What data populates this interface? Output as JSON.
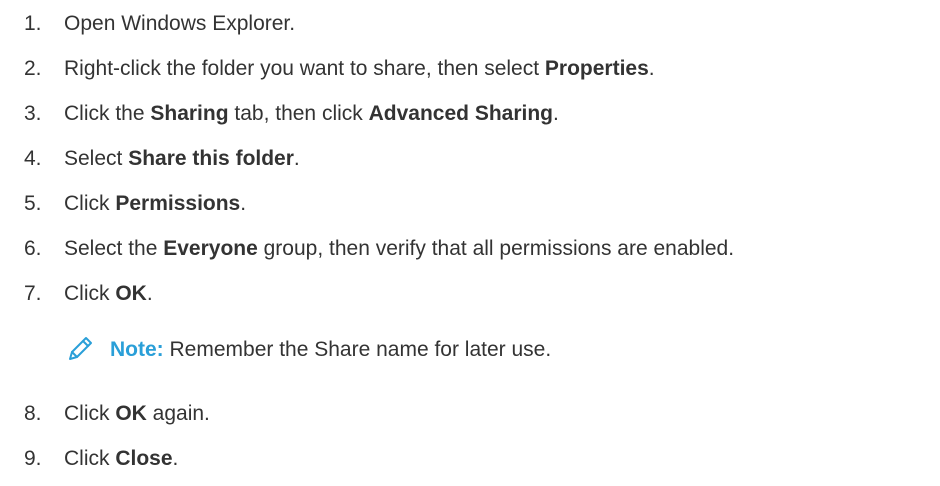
{
  "steps": [
    {
      "number": "1.",
      "parts": [
        {
          "t": "Open Windows Explorer.",
          "b": false
        }
      ]
    },
    {
      "number": "2.",
      "parts": [
        {
          "t": "Right-click the folder you want to share, then select ",
          "b": false
        },
        {
          "t": "Properties",
          "b": true
        },
        {
          "t": ".",
          "b": false
        }
      ]
    },
    {
      "number": "3.",
      "parts": [
        {
          "t": "Click the ",
          "b": false
        },
        {
          "t": "Sharing",
          "b": true
        },
        {
          "t": " tab, then click ",
          "b": false
        },
        {
          "t": "Advanced Sharing",
          "b": true
        },
        {
          "t": ".",
          "b": false
        }
      ]
    },
    {
      "number": "4.",
      "parts": [
        {
          "t": "Select ",
          "b": false
        },
        {
          "t": "Share this folder",
          "b": true
        },
        {
          "t": ".",
          "b": false
        }
      ]
    },
    {
      "number": "5.",
      "parts": [
        {
          "t": "Click ",
          "b": false
        },
        {
          "t": "Permissions",
          "b": true
        },
        {
          "t": ".",
          "b": false
        }
      ]
    },
    {
      "number": "6.",
      "parts": [
        {
          "t": "Select the ",
          "b": false
        },
        {
          "t": "Everyone",
          "b": true
        },
        {
          "t": " group, then verify that all permissions are enabled.",
          "b": false
        }
      ]
    },
    {
      "number": "7.",
      "parts": [
        {
          "t": "Click ",
          "b": false
        },
        {
          "t": "OK",
          "b": true
        },
        {
          "t": ".",
          "b": false
        }
      ]
    },
    {
      "number": "8.",
      "parts": [
        {
          "t": "Click ",
          "b": false
        },
        {
          "t": "OK",
          "b": true
        },
        {
          "t": " again.",
          "b": false
        }
      ]
    },
    {
      "number": "9.",
      "parts": [
        {
          "t": "Click ",
          "b": false
        },
        {
          "t": "Close",
          "b": true
        },
        {
          "t": ".",
          "b": false
        }
      ]
    }
  ],
  "note": {
    "label": "Note:",
    "text": " Remember the Share name for later use.",
    "icon": "pencil-icon",
    "accent_color": "#2a9fd8"
  }
}
